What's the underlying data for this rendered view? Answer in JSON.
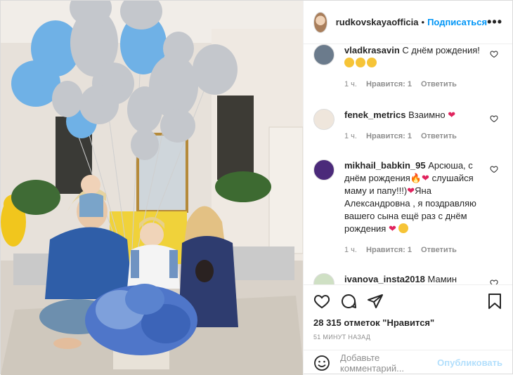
{
  "header": {
    "username": "rudkovskayaofficia",
    "separator": "•",
    "follow_label": "Подписаться",
    "more_label": "•••"
  },
  "comments": [
    {
      "user": "vladkrasavin",
      "text": "С днём рождения!",
      "time": "1 ч.",
      "likes": "Нравится: 1",
      "reply": "Ответить",
      "avatar_color": "#6b7b8c"
    },
    {
      "user": "fenek_metrics",
      "text": "Взаимно",
      "time": "1 ч.",
      "likes": "Нравится: 1",
      "reply": "Ответить",
      "avatar_color": "#efe6dc"
    },
    {
      "user": "mikhail_babkin_95",
      "text_1": "Арсюша, с днём рождения",
      "text_2": "слушайся маму и папу!!!)",
      "text_3": "Яна Александровна , я поздравляю вашего сына ещё раз с днём рождения",
      "time": "1 ч.",
      "likes": "Нравится: 1",
      "reply": "Ответить",
      "avatar_color": "#4b2a7a"
    },
    {
      "user": "ivanova_insta2018",
      "text": "Мамин сыночек!!!",
      "avatar_color": "#cfe0c4"
    }
  ],
  "likes_text": "28 315 отметок \"Нравится\"",
  "time_ago": "51 МИНУТ НАЗАД",
  "add_comment": {
    "placeholder": "Добавьте комментарий...",
    "publish_label": "Опубликовать"
  },
  "colors": {
    "accent": "#0095f6",
    "publish_disabled": "#b2dffc",
    "heart_red": "#e0245e",
    "muted": "#8e8e8e"
  }
}
